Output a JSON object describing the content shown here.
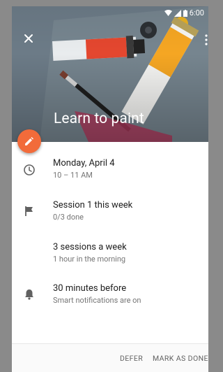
{
  "status_bar": {
    "time": "6:00"
  },
  "hero": {
    "title": "Learn to paint"
  },
  "details": [
    {
      "icon": "clock-icon",
      "primary": "Monday, April 4",
      "secondary": "10 – 11 AM"
    },
    {
      "icon": "flag-icon",
      "primary": "Session 1 this week",
      "secondary": "0/3 done"
    },
    {
      "icon": "",
      "primary": "3 sessions a week",
      "secondary": "1 hour in the morning"
    },
    {
      "icon": "bell-icon",
      "primary": "30 minutes before",
      "secondary": "Smart notifications are on"
    }
  ],
  "actions": {
    "defer": "DEFER",
    "mark_done": "MARK AS DONE"
  },
  "colors": {
    "accent": "#f26b3a",
    "hero_bg": "#6c7b87"
  }
}
